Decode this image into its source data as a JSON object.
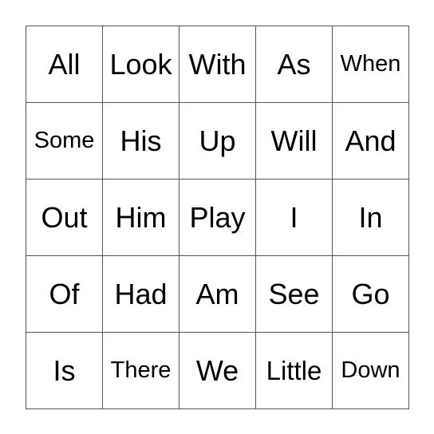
{
  "bingo": {
    "cells": [
      [
        "All",
        "Look",
        "With",
        "As",
        "When"
      ],
      [
        "Some",
        "His",
        "Up",
        "Will",
        "And"
      ],
      [
        "Out",
        "Him",
        "Play",
        "I",
        "In"
      ],
      [
        "Of",
        "Had",
        "Am",
        "See",
        "Go"
      ],
      [
        "Is",
        "There",
        "We",
        "Little",
        "Down"
      ]
    ]
  }
}
